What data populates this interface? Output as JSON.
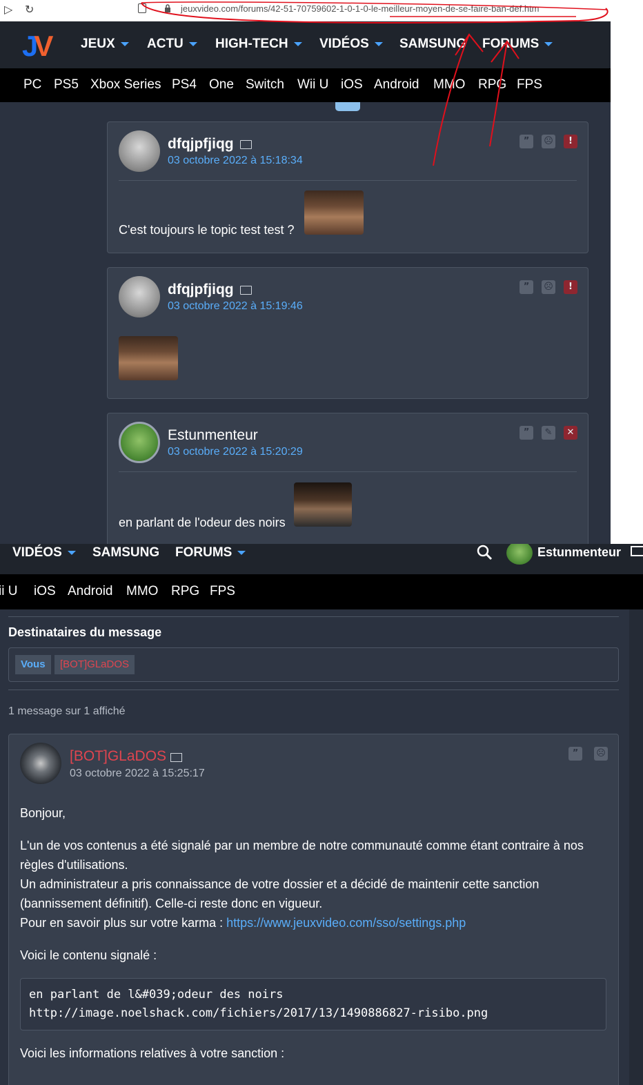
{
  "browser": {
    "url": "jeuxvideo.com/forums/42-51-70759602-1-0-1-0-le-meilleur-moyen-de-se-faire-ban-def.htm"
  },
  "nav_top": {
    "logo": "JV",
    "items": [
      "JEUX",
      "ACTU",
      "HIGH-TECH",
      "VIDÉOS",
      "SAMSUNG",
      "FORUMS"
    ]
  },
  "nav_platforms": [
    "PC",
    "PS5",
    "Xbox Series",
    "PS4",
    "One",
    "Switch",
    "Wii U",
    "iOS",
    "Android",
    "MMO",
    "RPG",
    "FPS"
  ],
  "posts": [
    {
      "username": "dfqjpfjiqg",
      "date": "03 octobre 2022 à 15:18:34",
      "text": "C'est toujours le topic test test ?"
    },
    {
      "username": "dfqjpfjiqg",
      "date": "03 octobre 2022 à 15:19:46",
      "text": ""
    },
    {
      "username": "Estunmenteur",
      "date": "03 octobre 2022 à 15:20:29",
      "text": "en parlant de l'odeur des noirs"
    }
  ],
  "bottom_nav": {
    "items": [
      "VIDÉOS",
      "SAMSUNG",
      "FORUMS"
    ],
    "user": "Estunmenteur",
    "platforms": [
      "ii U",
      "iOS",
      "Android",
      "MMO",
      "RPG",
      "FPS"
    ]
  },
  "recipients": {
    "heading": "Destinataires du message",
    "tags": [
      "Vous",
      "[BOT]GLaDOS"
    ]
  },
  "message_count": "1 message sur 1 affiché",
  "message": {
    "username": "[BOT]GLaDOS",
    "date": "03 octobre 2022 à 15:25:17",
    "greeting": "Bonjour,",
    "para1": "L'un de vos contenus a été signalé par un membre de notre communauté comme étant contraire à nos règles d'utilisations.",
    "para2": "Un administrateur a pris connaissance de votre dossier et a décidé de maintenir cette sanction (bannissement définitif). Celle-ci reste donc en vigueur.",
    "para3_prefix": "Pour en savoir plus sur votre karma : ",
    "para3_link": "https://www.jeuxvideo.com/sso/settings.php",
    "reported_heading": "Voici le contenu signalé :",
    "code_line1": "en parlant de l&#039;odeur des noirs",
    "code_line2": "http://image.noelshack.com/fichiers/2017/13/1490886827-risibo.png",
    "sanction_heading": "Voici les informations relatives à votre sanction :"
  },
  "colors": {
    "bg": "#2b3240",
    "link": "#5aaefa",
    "bot_red": "#e0454f",
    "annotation_red": "#e0101c"
  }
}
